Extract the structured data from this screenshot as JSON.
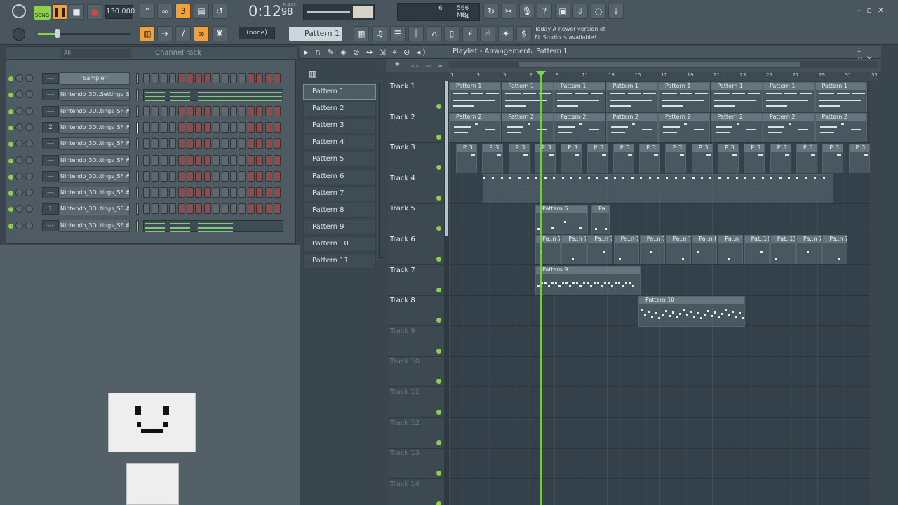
{
  "toolbar": {
    "song_label": "SONG",
    "tempo": "130.000",
    "time": "0:12",
    "time_sub": "98",
    "time_unit": "M:S:CS",
    "cpu": "6",
    "mem": "566 MB",
    "poly": "64",
    "pattern_selector": "Pattern 1",
    "none_label": "(none)",
    "news_line1": "Today A newer version of",
    "news_line2": "FL Studio is available!",
    "icons": [
      "play-icon",
      "stop-icon",
      "record-icon",
      "undo-icon",
      "cut-icon",
      "mic-icon",
      "help-icon",
      "save-icon",
      "render-icon",
      "chat-icon",
      "download-icon"
    ]
  },
  "channel_rack": {
    "title": "Channel rack",
    "filter": "All",
    "add_label": "+",
    "channels": [
      {
        "name": "Sampler",
        "mixer": "---",
        "mode": "steps"
      },
      {
        "name": "Nintendo_3D..Settings_SF",
        "mixer": "---",
        "mode": "roll"
      },
      {
        "name": "Nintendo_3D..tings_SF #2",
        "mixer": "---",
        "mode": "steps"
      },
      {
        "name": "Nintendo_3D..tings_SF #3",
        "mixer": "2",
        "mode": "steps"
      },
      {
        "name": "Nintendo_3D..tings_SF #4",
        "mixer": "---",
        "mode": "steps"
      },
      {
        "name": "Nintendo_3D..tings_SF #8",
        "mixer": "---",
        "mode": "steps"
      },
      {
        "name": "Nintendo_3D..tings_SF #5",
        "mixer": "---",
        "mode": "steps"
      },
      {
        "name": "Nintendo_3D..tings_SF #6",
        "mixer": "---",
        "mode": "steps"
      },
      {
        "name": "Nintendo_3D..tings_SF #7",
        "mixer": "1",
        "mode": "steps"
      },
      {
        "name": "Nintendo_3D..tings_SF #9",
        "mixer": "---",
        "mode": "roll"
      }
    ]
  },
  "playlist": {
    "breadcrumb": "Playlist - Arrangement",
    "sep": "›",
    "current": "Pattern 1",
    "patterns": [
      "Pattern 1",
      "Pattern 2",
      "Pattern 3",
      "Pattern 4",
      "Pattern 5",
      "Pattern 6",
      "Pattern 7",
      "Pattern 8",
      "Pattern 9",
      "Pattern 10",
      "Pattern 11"
    ],
    "ruler": [
      "1",
      "3",
      "5",
      "7",
      "9",
      "11",
      "13",
      "15",
      "17",
      "19",
      "21",
      "23",
      "25",
      "27",
      "29",
      "31",
      "33"
    ],
    "tracks": [
      "Track 1",
      "Track 2",
      "Track 3",
      "Track 4",
      "Track 5",
      "Track 6",
      "Track 7",
      "Track 8",
      "Track 9",
      "Track 10",
      "Track 11",
      "Track 12",
      "Track 13",
      "Track 14"
    ],
    "clips": {
      "t1": "Pattern 1",
      "t2": "Pattern 2",
      "t3": "P..3",
      "t5a": "Pattern 6",
      "t5b": "Pa..6",
      "t6": [
        "Pa..n 7",
        "Pa..n 7",
        "Pa..n 7",
        "Pa..n 7",
        "Pa..n 7",
        "Pa..n 7",
        "Pa..n 8",
        "Pa..n 7",
        "Pat..11",
        "Pat..11",
        "Pa..n 7",
        "Pa..n 7"
      ],
      "t7": "Pattern 9",
      "t8": "Pattern 10"
    },
    "tool_labels": {
      "m1": "NOTE",
      "m2": "CHAN",
      "m3": "PAT"
    }
  },
  "colors": {
    "accent": "#f2a13a",
    "led": "#8ed04a",
    "playhead": "#7fd34d"
  }
}
